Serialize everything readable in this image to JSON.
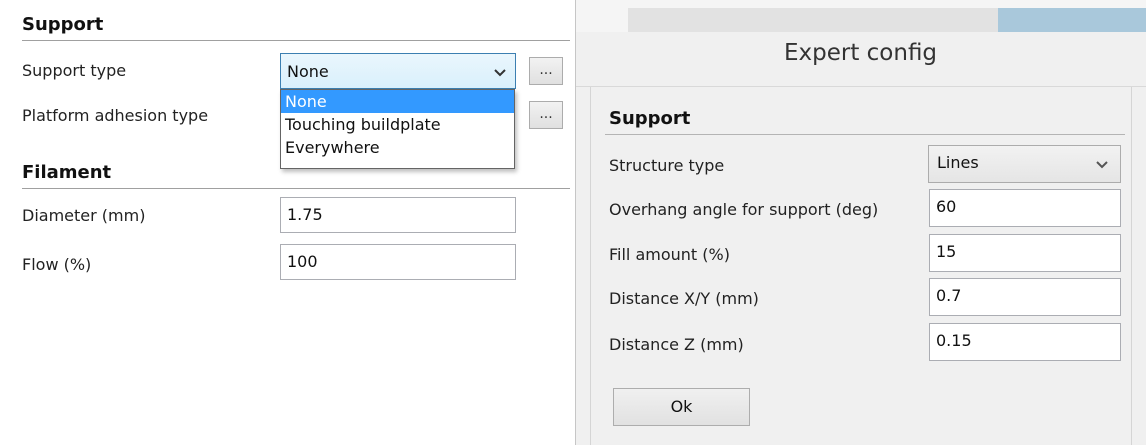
{
  "main": {
    "support_section": {
      "title": "Support",
      "support_type_label": "Support type",
      "support_type_value": "None",
      "adhesion_label": "Platform adhesion type",
      "more_label": "..."
    },
    "support_type_options": [
      "None",
      "Touching buildplate",
      "Everywhere"
    ],
    "filament_section": {
      "title": "Filament",
      "diameter_label": "Diameter (mm)",
      "diameter_value": "1.75",
      "flow_label": "Flow (%)",
      "flow_value": "100"
    }
  },
  "dialog": {
    "title": "Expert config",
    "section_title": "Support",
    "structure_type_label": "Structure type",
    "structure_type_value": "Lines",
    "overhang_label": "Overhang angle for support (deg)",
    "overhang_value": "60",
    "fill_label": "Fill amount (%)",
    "fill_value": "15",
    "dist_xy_label": "Distance X/Y (mm)",
    "dist_xy_value": "0.7",
    "dist_z_label": "Distance Z (mm)",
    "dist_z_value": "0.15",
    "ok_label": "Ok"
  },
  "colors": {
    "selection": "#3399ff",
    "combo_border": "#3c7fb1",
    "dialog_bg": "#f0f0f0"
  },
  "icons": {
    "dropdown": "chevron-down-icon"
  }
}
